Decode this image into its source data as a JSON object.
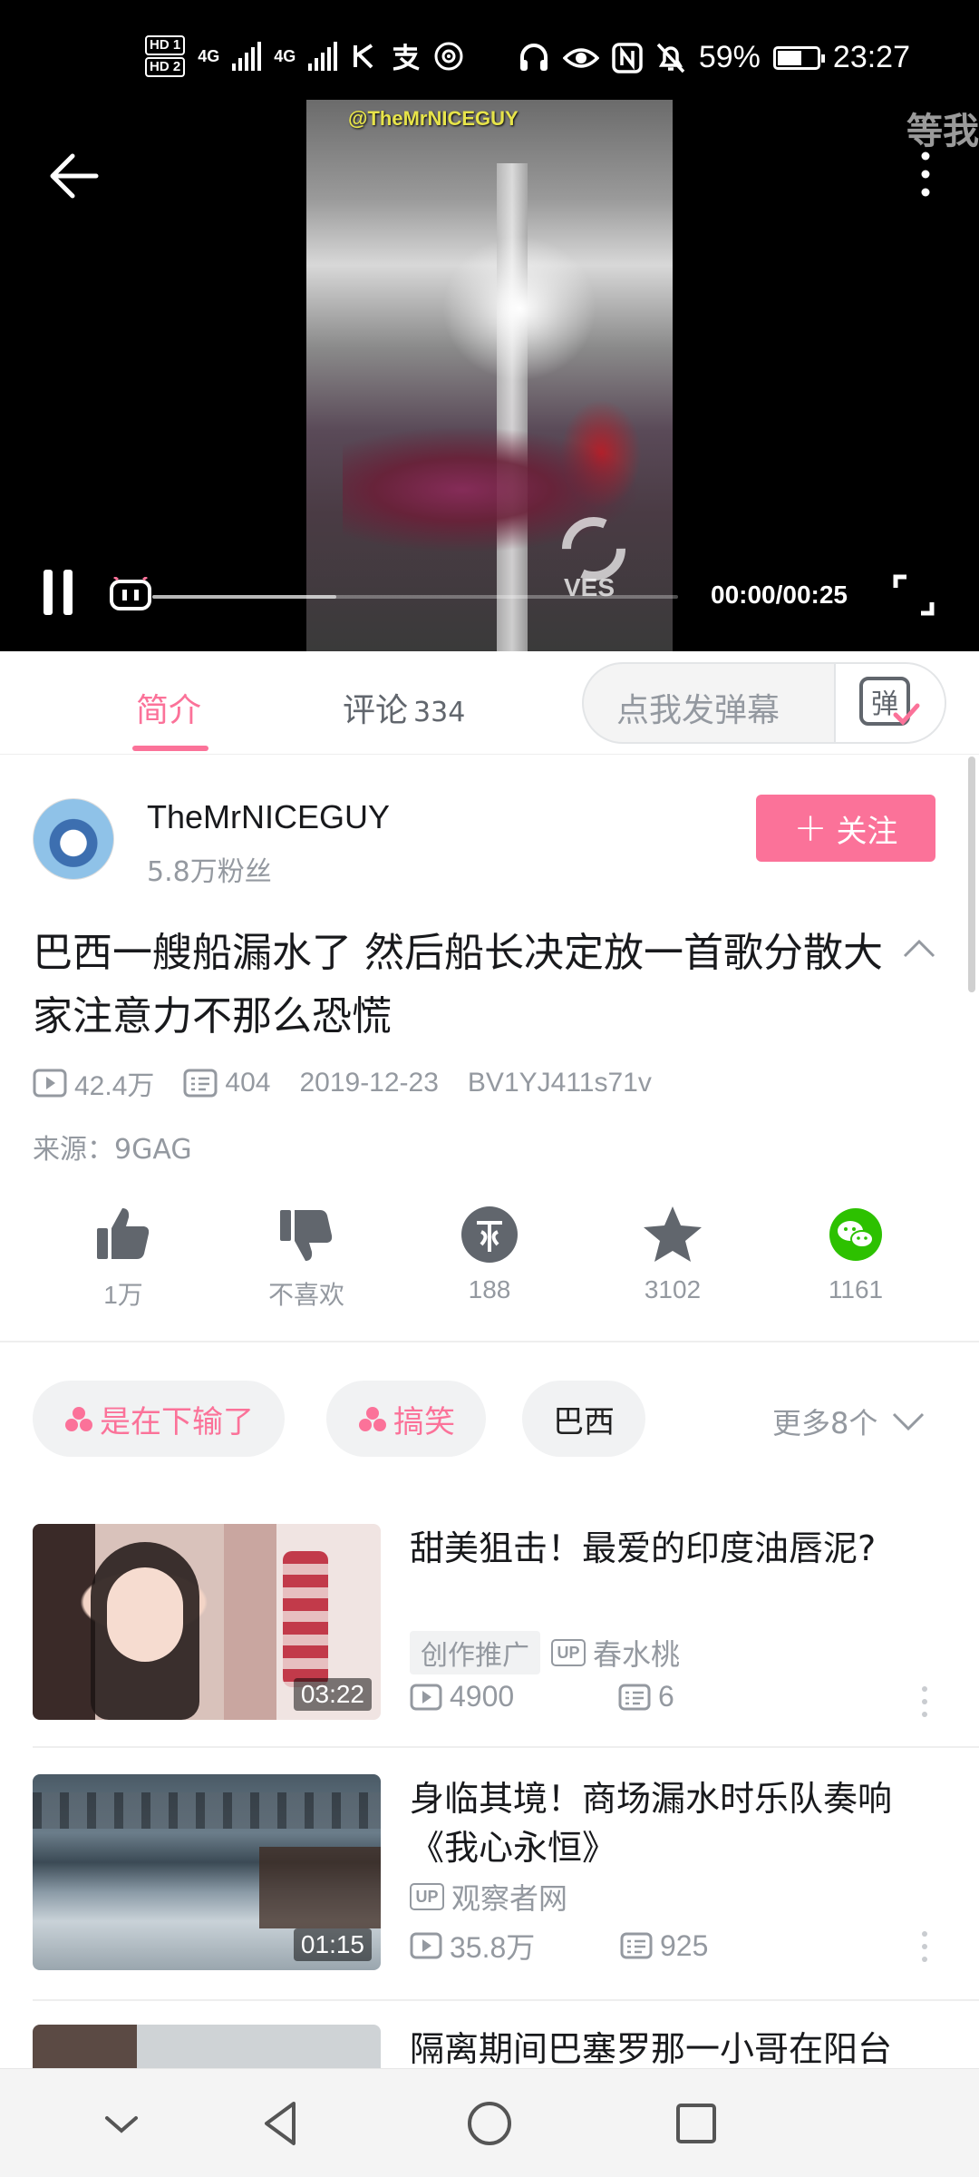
{
  "status_bar": {
    "hd1": "HD 1",
    "hd2": "HD 2",
    "net1": "4G",
    "net2": "4G",
    "battery_percent": "59%",
    "time": "23:27"
  },
  "player": {
    "watermark_top": "@TheMrNICEGUY",
    "watermark_logo": "VES",
    "floating_danmaku": "等我",
    "time_display": "00:00/00:25",
    "progress_played": 0.0,
    "progress_buffered": 0.35
  },
  "tabs": {
    "intro": "简介",
    "comments": "评论",
    "comments_count": "334",
    "danmaku_placeholder": "点我发弹幕"
  },
  "uploader": {
    "name": "TheMrNICEGUY",
    "fans": "5.8万粉丝",
    "follow_label": "关注"
  },
  "video": {
    "title": "巴西一艘船漏水了 然后船长决定放一首歌分散大家注意力不那么恐慌",
    "views": "42.4万",
    "danmaku_count": "404",
    "date": "2019-12-23",
    "bvid": "BV1YJ411s71v",
    "source": "来源：9GAG"
  },
  "actions": [
    {
      "icon": "thumbs-up-icon",
      "label": "1万"
    },
    {
      "icon": "thumbs-down-icon",
      "label": "不喜欢"
    },
    {
      "icon": "coin-icon",
      "label": "188"
    },
    {
      "icon": "star-icon",
      "label": "3102"
    },
    {
      "icon": "wechat-share-icon",
      "label": "1161"
    }
  ],
  "tags": [
    {
      "label": "是在下输了",
      "highlight": true
    },
    {
      "label": "搞笑",
      "highlight": true
    },
    {
      "label": "巴西",
      "highlight": false
    }
  ],
  "tags_more": "更多8个",
  "related": [
    {
      "title": "甜美狙击！最爱的印度油唇泥?",
      "duration": "03:22",
      "badge": "创作推广",
      "up_label": "UP",
      "author": "春水桃",
      "views": "4900",
      "danmaku": "6"
    },
    {
      "title": "身临其境！商场漏水时乐队奏响《我心永恒》",
      "duration": "01:15",
      "up_label": "UP",
      "author": "观察者网",
      "views": "35.8万",
      "danmaku": "925"
    },
    {
      "title": "隔离期间巴塞罗那一小哥在阳台"
    }
  ],
  "colors": {
    "accent": "#fb7299",
    "text_secondary": "#9499a0",
    "wechat": "#2dc100"
  }
}
